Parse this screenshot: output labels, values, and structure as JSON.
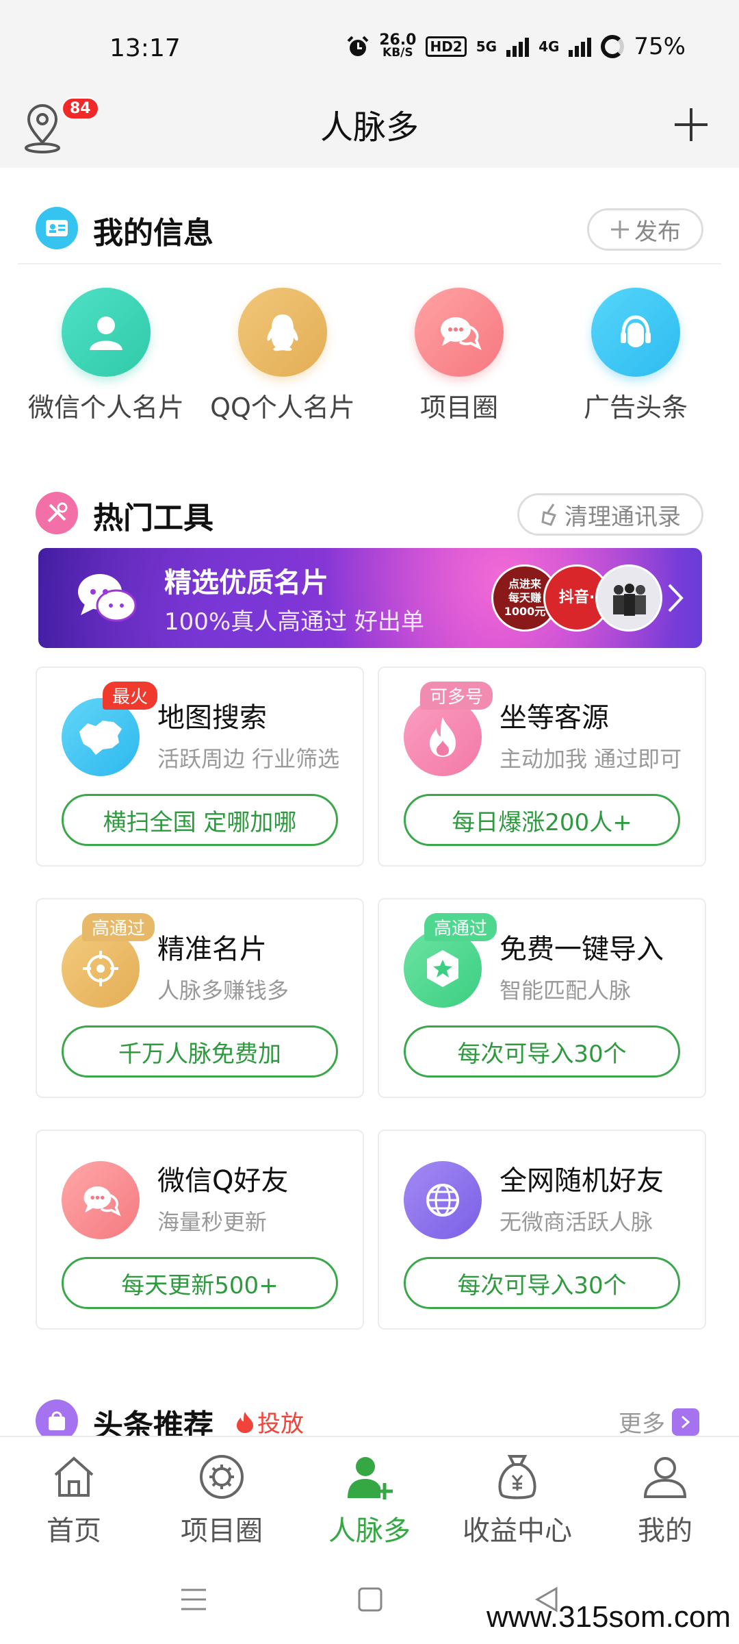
{
  "status_bar": {
    "time": "13:17",
    "net_speed_value": "26.0",
    "net_speed_unit": "KB/S",
    "hd": "HD2",
    "net1": "5G",
    "net2": "4G",
    "battery": "75%"
  },
  "header": {
    "title": "人脉多",
    "location_badge": "84"
  },
  "my_info": {
    "title": "我的信息",
    "publish_label": "发布",
    "items": [
      {
        "label": "微信个人名片",
        "icon": "person-icon",
        "color": "#3fd7b8"
      },
      {
        "label": "QQ个人名片",
        "icon": "qq-penguin-icon",
        "color": "#ebbb67"
      },
      {
        "label": "项目圈",
        "icon": "chat-bubbles-icon",
        "color": "#fb8e94"
      },
      {
        "label": "广告头条",
        "icon": "headset-icon",
        "color": "#3ecbf4"
      }
    ]
  },
  "hot_tools": {
    "title": "热门工具",
    "clean_label": "清理通讯录",
    "banner": {
      "title": "精选优质名片",
      "subtitle": "100%真人高通过 好出单",
      "circle1_text": "点进来\n每天赚\n1000元",
      "circle2_text": "抖音·",
      "circle3_text": ""
    },
    "cards": [
      {
        "title": "地图搜索",
        "subtitle": "活跃周边 行业筛选",
        "button": "横扫全国 定哪加哪",
        "tag": "最火",
        "tag_color": "#f03a2e",
        "icon": "china-map-icon",
        "icon_color": "#3ec4f2"
      },
      {
        "title": "坐等客源",
        "subtitle": "主动加我 通过即可",
        "button": "每日爆涨200人+",
        "tag": "可多号",
        "tag_color": "#f28bb0",
        "icon": "flame-icon",
        "icon_color": "#f685ad"
      },
      {
        "title": "精准名片",
        "subtitle": "人脉多赚钱多",
        "button": "千万人脉免费加",
        "tag": "高通过",
        "tag_color": "#e6b868",
        "icon": "target-icon",
        "icon_color": "#ebbc66"
      },
      {
        "title": "免费一键导入",
        "subtitle": "智能匹配人脉",
        "button": "每次可导入30个",
        "tag": "高通过",
        "tag_color": "#4fd68f",
        "icon": "star-badge-icon",
        "icon_color": "#52da90"
      },
      {
        "title": "微信Q好友",
        "subtitle": "海量秒更新",
        "button": "每天更新500+",
        "tag": "",
        "tag_color": "",
        "icon": "chat-bubbles-icon",
        "icon_color": "#f9878b"
      },
      {
        "title": "全网随机好友",
        "subtitle": "无微商活跃人脉",
        "button": "每次可导入30个",
        "tag": "",
        "tag_color": "",
        "icon": "globe-icon",
        "icon_color": "#8c70ec"
      }
    ]
  },
  "news": {
    "title": "头条推荐",
    "tag": "投放",
    "more": "更多"
  },
  "tabbar": {
    "active_color": "#35a844",
    "items": [
      {
        "label": "首页",
        "icon": "home-icon"
      },
      {
        "label": "项目圈",
        "icon": "gear-circle-icon"
      },
      {
        "label": "人脉多",
        "icon": "add-user-icon"
      },
      {
        "label": "收益中心",
        "icon": "money-bag-icon"
      },
      {
        "label": "我的",
        "icon": "profile-icon"
      }
    ]
  },
  "watermark": "www.315som.com"
}
